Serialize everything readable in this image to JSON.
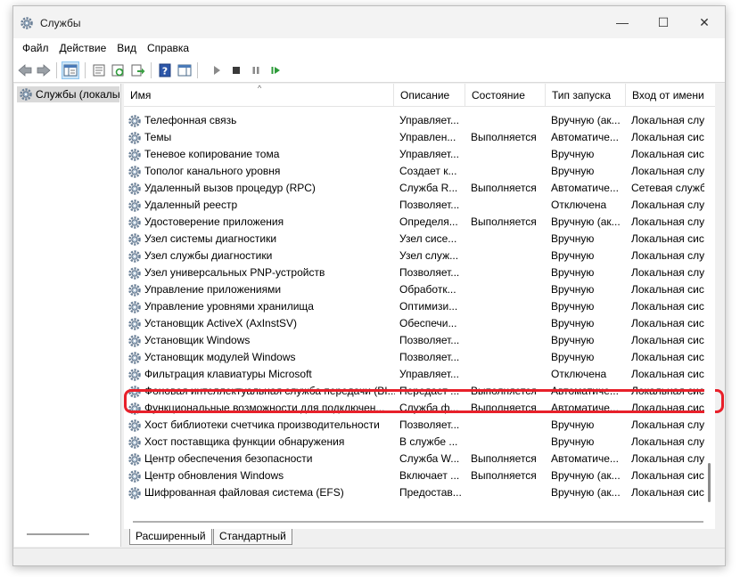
{
  "window": {
    "title": "Службы",
    "controls": {
      "minimize": "—",
      "maximize": "☐",
      "close": "✕"
    }
  },
  "menu": [
    "Файл",
    "Действие",
    "Вид",
    "Справка"
  ],
  "tree": {
    "root_label": "Службы (локальные)"
  },
  "columns": [
    "Имя",
    "Описание",
    "Состояние",
    "Тип запуска",
    "Вход от имени"
  ],
  "services": [
    {
      "name": "Телефонная связь",
      "description": "Управляет...",
      "state": "",
      "startup": "Вручную (ак...",
      "logon": "Локальная слу..."
    },
    {
      "name": "Темы",
      "description": "Управлен...",
      "state": "Выполняется",
      "startup": "Автоматиче...",
      "logon": "Локальная сис..."
    },
    {
      "name": "Теневое копирование тома",
      "description": "Управляет...",
      "state": "",
      "startup": "Вручную",
      "logon": "Локальная сис..."
    },
    {
      "name": "Тополог канального уровня",
      "description": "Создает к...",
      "state": "",
      "startup": "Вручную",
      "logon": "Локальная слу..."
    },
    {
      "name": "Удаленный вызов процедур (RPC)",
      "description": "Служба R...",
      "state": "Выполняется",
      "startup": "Автоматиче...",
      "logon": "Сетевая служба"
    },
    {
      "name": "Удаленный реестр",
      "description": "Позволяет...",
      "state": "",
      "startup": "Отключена",
      "logon": "Локальная слу..."
    },
    {
      "name": "Удостоверение приложения",
      "description": "Определя...",
      "state": "Выполняется",
      "startup": "Вручную (ак...",
      "logon": "Локальная слу..."
    },
    {
      "name": "Узел системы диагностики",
      "description": "Узел сисе...",
      "state": "",
      "startup": "Вручную",
      "logon": "Локальная сис..."
    },
    {
      "name": "Узел службы диагностики",
      "description": "Узел служ...",
      "state": "",
      "startup": "Вручную",
      "logon": "Локальная слу..."
    },
    {
      "name": "Узел универсальных PNP-устройств",
      "description": "Позволяет...",
      "state": "",
      "startup": "Вручную",
      "logon": "Локальная слу..."
    },
    {
      "name": "Управление приложениями",
      "description": "Обработк...",
      "state": "",
      "startup": "Вручную",
      "logon": "Локальная сис..."
    },
    {
      "name": "Управление уровнями хранилища",
      "description": "Оптимизи...",
      "state": "",
      "startup": "Вручную",
      "logon": "Локальная сис..."
    },
    {
      "name": "Установщик ActiveX (AxInstSV)",
      "description": "Обеспечи...",
      "state": "",
      "startup": "Вручную",
      "logon": "Локальная сис..."
    },
    {
      "name": "Установщик Windows",
      "description": "Позволяет...",
      "state": "",
      "startup": "Вручную",
      "logon": "Локальная сис..."
    },
    {
      "name": "Установщик модулей Windows",
      "description": "Позволяет...",
      "state": "",
      "startup": "Вручную",
      "logon": "Локальная сис..."
    },
    {
      "name": "Фильтрация клавиатуры Microsoft",
      "description": "Управляет...",
      "state": "",
      "startup": "Отключена",
      "logon": "Локальная сис..."
    },
    {
      "name": "Фоновая интеллектуальная служба передачи (BI...",
      "description": "Передает ...",
      "state": "Выполняется",
      "startup": "Автоматиче...",
      "logon": "Локальная сис..."
    },
    {
      "name": "Функциональные возможности для подключен...",
      "description": "Служба ф...",
      "state": "Выполняется",
      "startup": "Автоматиче...",
      "logon": "Локальная сис..."
    },
    {
      "name": "Хост библиотеки счетчика производительности",
      "description": "Позволяет...",
      "state": "",
      "startup": "Вручную",
      "logon": "Локальная слу..."
    },
    {
      "name": "Хост поставщика функции обнаружения",
      "description": "В службе ...",
      "state": "",
      "startup": "Вручную",
      "logon": "Локальная слу..."
    },
    {
      "name": "Центр обеспечения безопасности",
      "description": "Служба W...",
      "state": "Выполняется",
      "startup": "Автоматиче...",
      "logon": "Локальная слу..."
    },
    {
      "name": "Центр обновления Windows",
      "description": "Включает ...",
      "state": "Выполняется",
      "startup": "Вручную (ак...",
      "logon": "Локальная сис..."
    },
    {
      "name": "Шифрованная файловая система (EFS)",
      "description": "Предостав...",
      "state": "",
      "startup": "Вручную (ак...",
      "logon": "Локальная сис..."
    }
  ],
  "tabs": [
    "Расширенный",
    "Стандартный"
  ],
  "colors": {
    "highlight_border": "#e8202a",
    "selection": "#d9d9d9"
  }
}
